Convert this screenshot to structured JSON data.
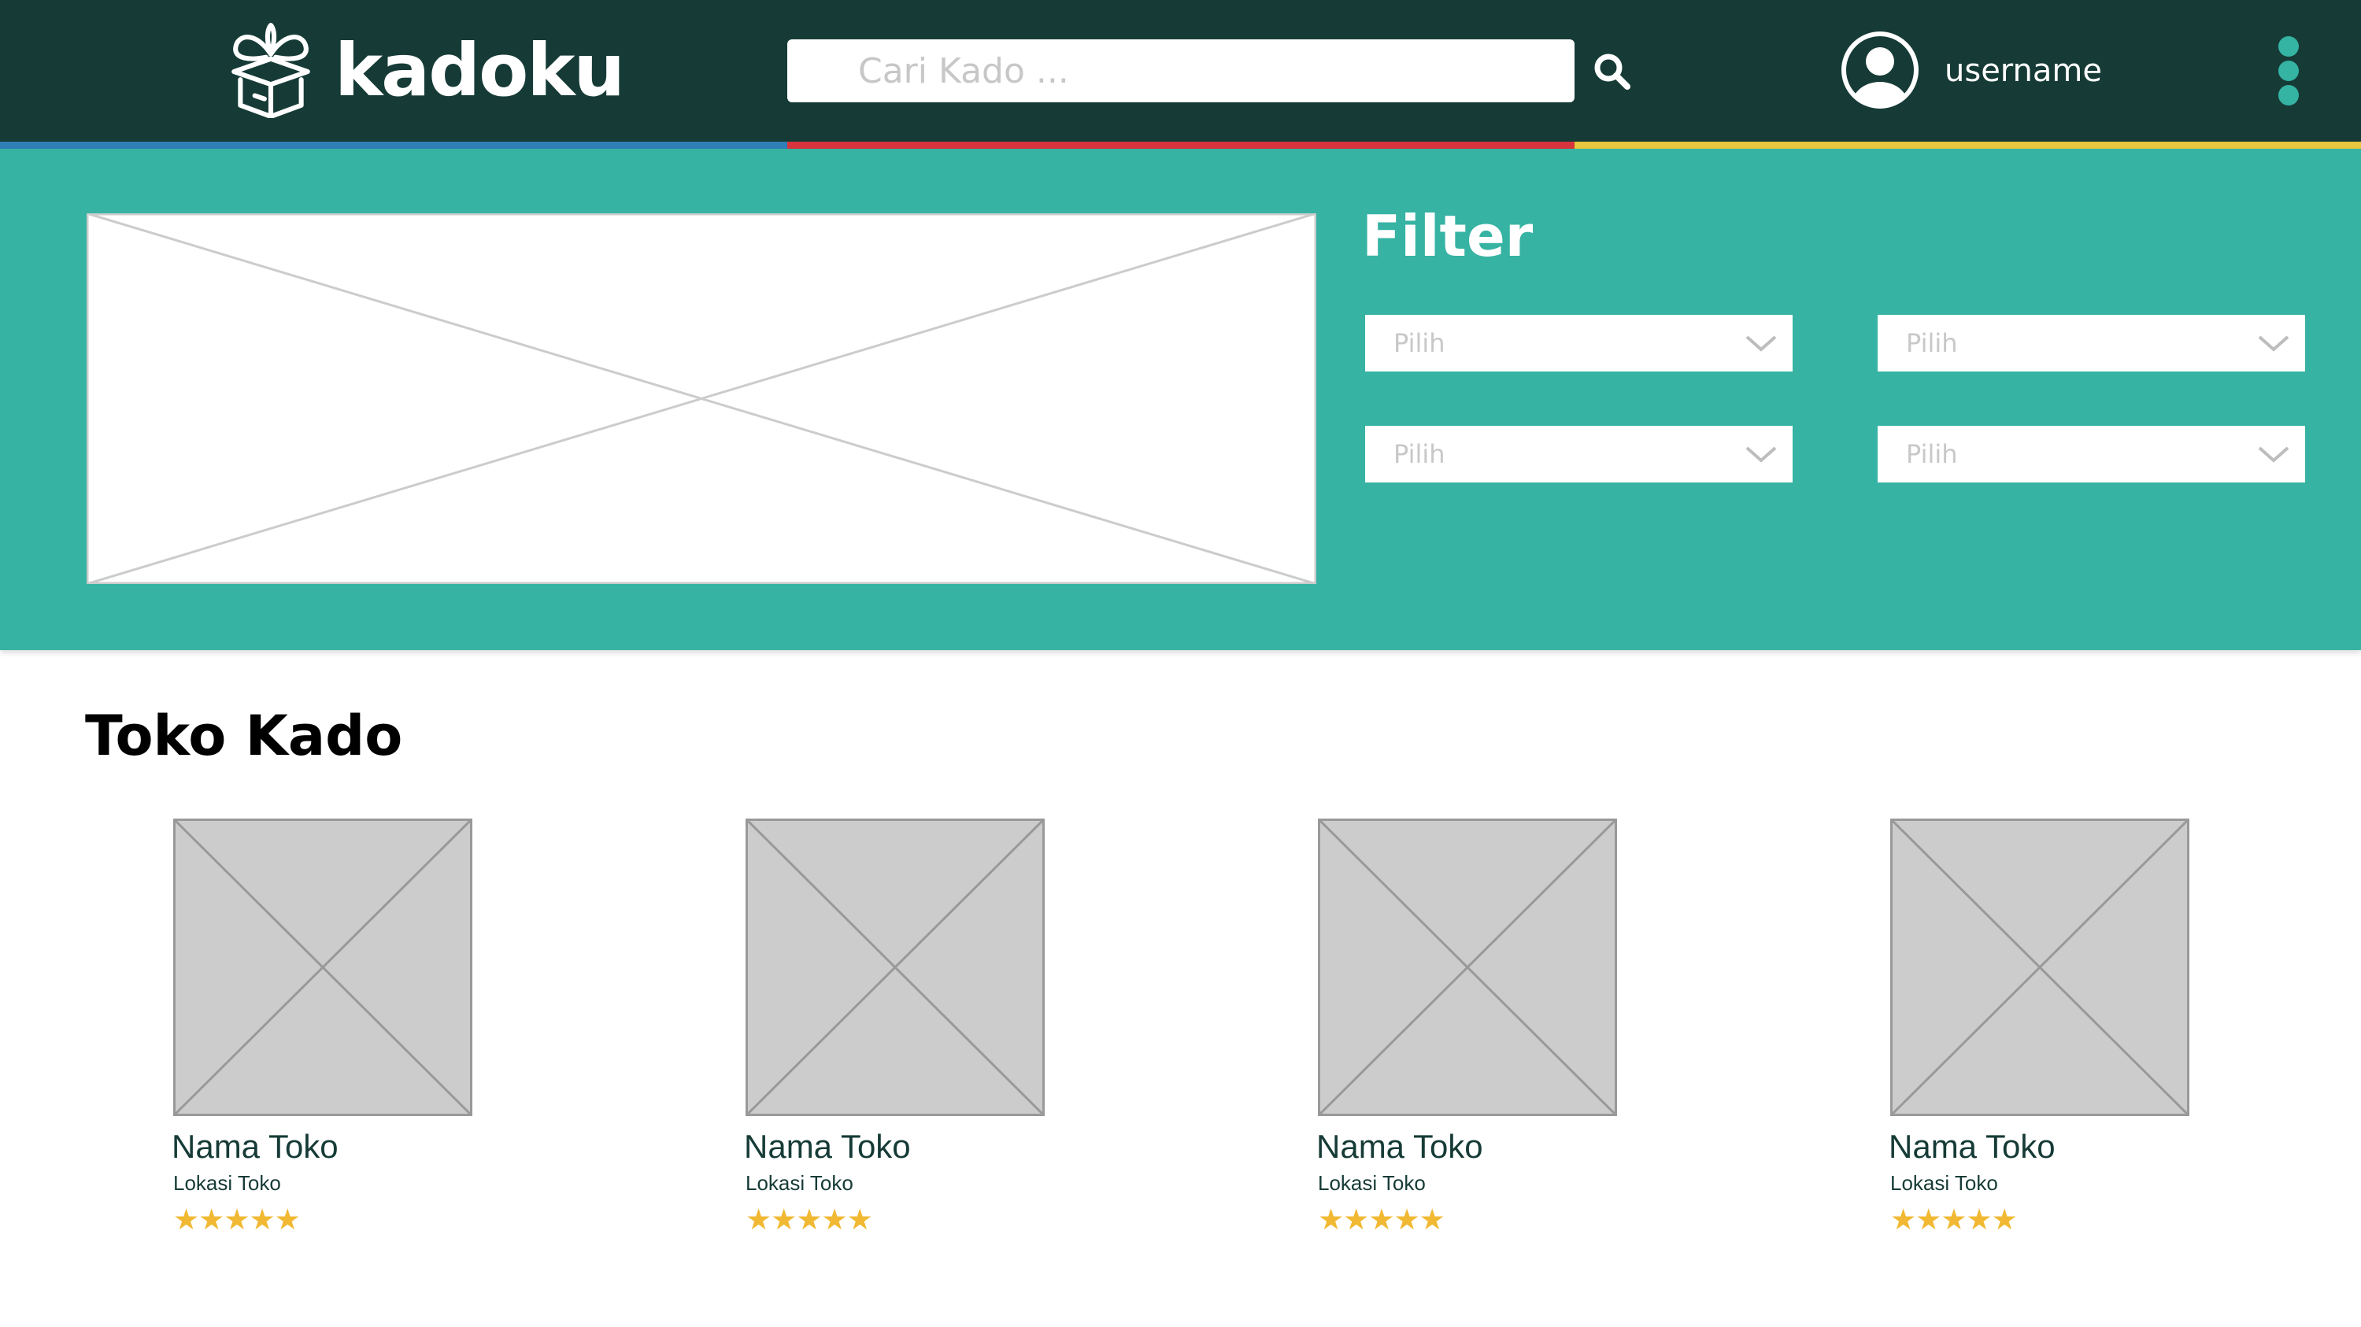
{
  "colors": {
    "topbar": "#163b36",
    "hero": "#36b3a3",
    "accent_blue": "#2f7fb6",
    "accent_red": "#d8343d",
    "accent_yellow": "#e8c63d",
    "star": "#f1b933"
  },
  "header": {
    "logo_text": "kadoku",
    "logo_icon": "gift-box-icon",
    "search_placeholder": "Cari Kado ...",
    "search_icon": "search-icon",
    "user_icon": "user-avatar-icon",
    "username": "username",
    "menu_icon": "kebab-menu-icon"
  },
  "hero": {
    "banner_image": "image-placeholder",
    "filter_title": "Filter",
    "filters": [
      {
        "placeholder": "Pilih"
      },
      {
        "placeholder": "Pilih"
      },
      {
        "placeholder": "Pilih"
      },
      {
        "placeholder": "Pilih"
      }
    ]
  },
  "stores_section": {
    "title": "Toko Kado",
    "stores": [
      {
        "name": "Nama Toko",
        "location": "Lokasi Toko",
        "rating": 5,
        "stars": "★★★★★"
      },
      {
        "name": "Nama Toko",
        "location": "Lokasi Toko",
        "rating": 5,
        "stars": "★★★★★"
      },
      {
        "name": "Nama Toko",
        "location": "Lokasi Toko",
        "rating": 5,
        "stars": "★★★★★"
      },
      {
        "name": "Nama Toko",
        "location": "Lokasi Toko",
        "rating": 5,
        "stars": "★★★★★"
      }
    ]
  }
}
